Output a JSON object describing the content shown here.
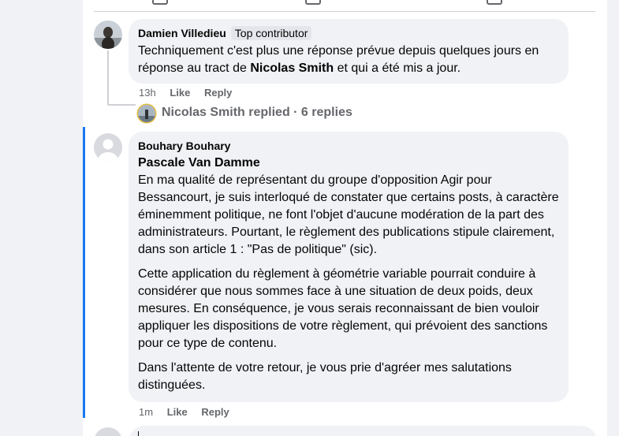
{
  "comments": [
    {
      "author": "Damien Villedieu",
      "badge": "Top contributor",
      "text_before": "Techniquement c'est plus une réponse prévue depuis quelques jours en réponse au tract de ",
      "mention": "Nicolas Smith",
      "text_after": " et qui a été mis a jour.",
      "time": "13h",
      "like": "Like",
      "reply": "Reply",
      "replies_summary": "Nicolas Smith replied · 6 replies"
    },
    {
      "author": "Bouhary Bouhary",
      "tagged": "Pascale Van Damme",
      "paragraphs": [
        "En ma qualité de représentant du groupe d'opposition Agir pour Bessancourt, je suis interloqué de constater que certains posts, à caractère éminemment politique, ne font l'objet d'aucune modération de la part des administrateurs. Pourtant, le règlement des publications stipule clairement, dans son article 1 : \"Pas de politique\" (sic).",
        "Cette application du règlement à géométrie variable pourrait conduire à considérer que nous sommes face à une situation de deux poids, deux mesures. En conséquence, je vous serais reconnaissant de bien vouloir appliquer les dispositions de votre règlement, qui prévoient des sanctions pour ce type de contenu.",
        "Dans l'attente de votre retour, je vous prie d'agréer mes salutations distinguées."
      ],
      "time": "1m",
      "like": "Like",
      "reply": "Reply"
    }
  ],
  "colors": {
    "highlight": "#1877f2",
    "bubble": "#f0f2f5",
    "secondary_text": "#65676b",
    "badge_ring": "#e4b93b"
  },
  "icons": [
    "like-icon",
    "comment-icon",
    "share-icon"
  ]
}
